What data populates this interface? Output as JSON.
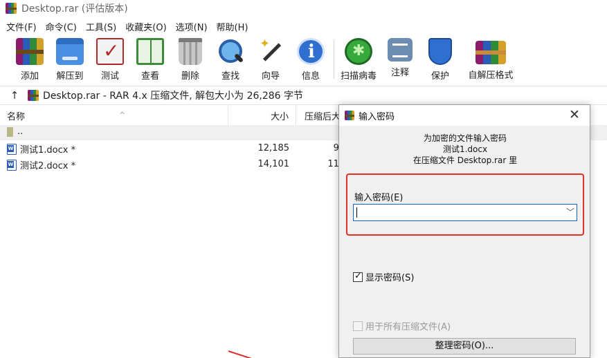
{
  "window": {
    "title": "Desktop.rar (评估版本)"
  },
  "menu": [
    "文件(F)",
    "命令(C)",
    "工具(S)",
    "收藏夹(O)",
    "选项(N)",
    "帮助(H)"
  ],
  "toolbar": {
    "add": "添加",
    "extract_to": "解压到",
    "test": "测试",
    "view": "查看",
    "delete": "删除",
    "find": "查找",
    "wizard": "向导",
    "info": "信息",
    "virus_scan": "扫描病毒",
    "comment": "注释",
    "protect": "保护",
    "sfx": "自解压格式"
  },
  "address": {
    "up_icon": "↑",
    "text": "Desktop.rar - RAR 4.x 压缩文件, 解包大小为 26,286 字节"
  },
  "filelist": {
    "columns": {
      "name": "名称",
      "size": "大小",
      "packed": "压缩后大"
    },
    "sort_indicator": "^",
    "rows": [
      {
        "name": "..",
        "size": "",
        "packed": ""
      },
      {
        "name": "测试1.docx *",
        "size": "12,185",
        "packed": "9,"
      },
      {
        "name": "测试2.docx *",
        "size": "14,101",
        "packed": "11,"
      }
    ]
  },
  "dialog": {
    "title": "输入密码",
    "close_icon": "✕",
    "info_line1": "为加密的文件输入密码",
    "info_line2": "测试1.docx",
    "info_line3": "在压缩文件 Desktop.rar 里",
    "password_label": "输入密码(E)",
    "password_value": "",
    "dropdown_icon": "﹀",
    "show_password": {
      "label": "显示密码(S)",
      "checked": true
    },
    "use_for_all": {
      "label": "用于所有压缩文件(A)",
      "checked": false,
      "enabled": false
    },
    "organize_button": "整理密码(O)..."
  },
  "colors": {
    "highlight_box": "#e03030",
    "accent": "#0a64c8"
  }
}
